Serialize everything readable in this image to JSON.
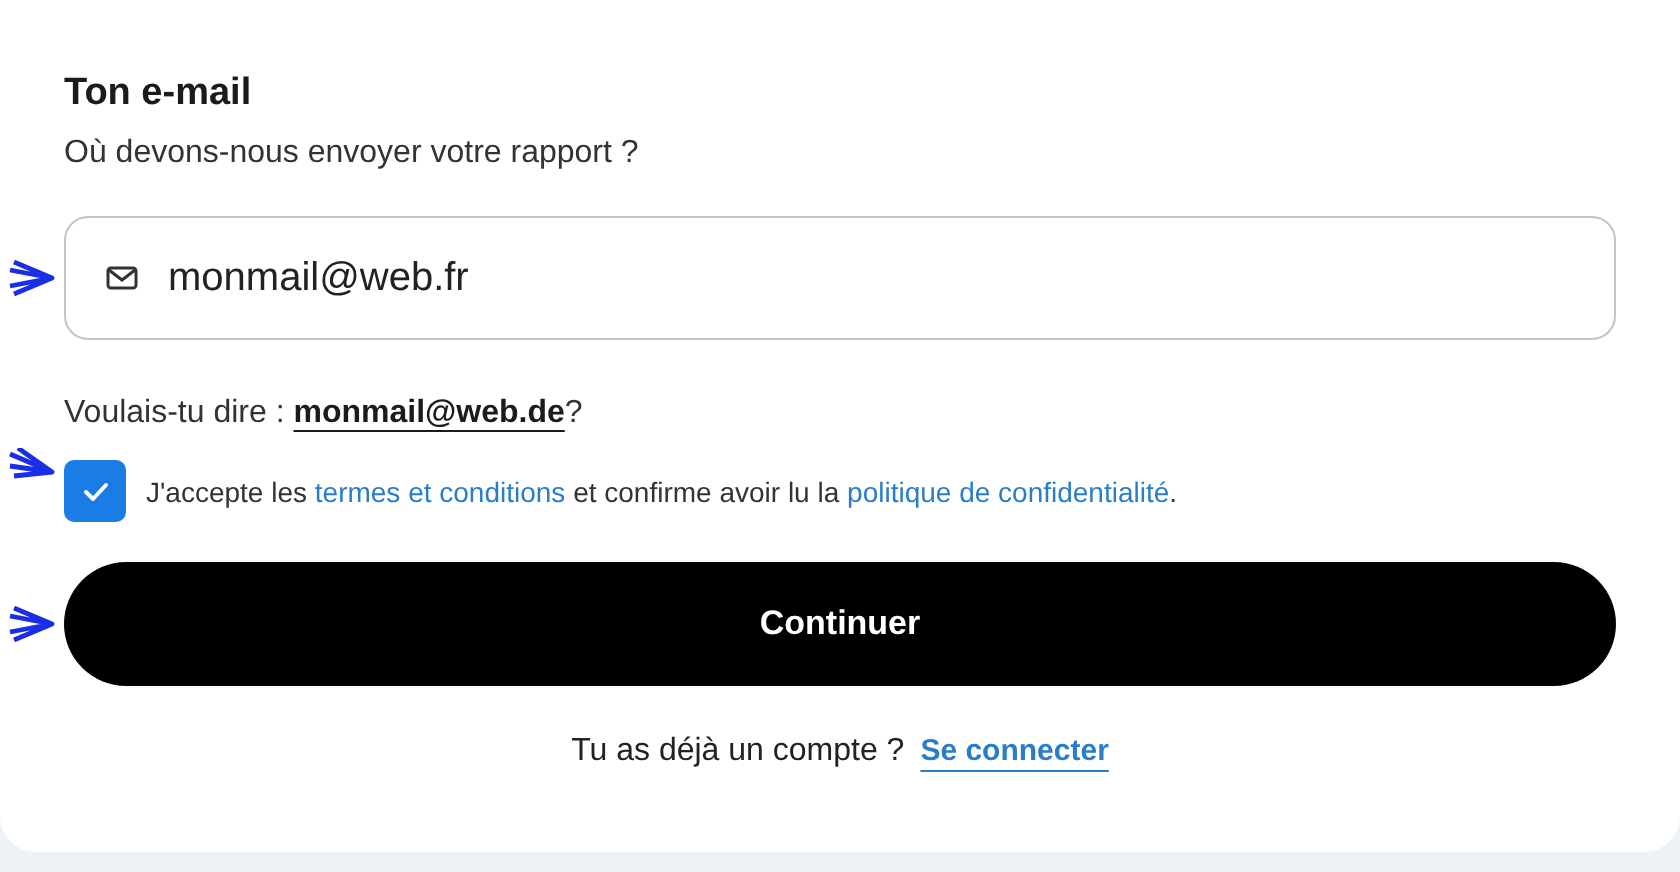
{
  "heading": "Ton e-mail",
  "subtitle": "Où devons-nous envoyer votre rapport ?",
  "email_field": {
    "value": "monmail@web.fr"
  },
  "suggestion": {
    "text": "Voulais-tu dire : ",
    "link": "monmail@web.de",
    "after": "?"
  },
  "consent": {
    "checked": true,
    "parts": [
      {
        "kind": "text",
        "text": "J'accepte les "
      },
      {
        "kind": "link",
        "text": "termes et conditions"
      },
      {
        "kind": "text",
        "text": " et confirme avoir lu la "
      },
      {
        "kind": "link",
        "text": "politique de confidentialité"
      },
      {
        "kind": "text",
        "text": "."
      }
    ]
  },
  "continue_button": "Continuer",
  "login": {
    "text": "Tu as déjà un compte ?",
    "link": "Se connecter"
  }
}
